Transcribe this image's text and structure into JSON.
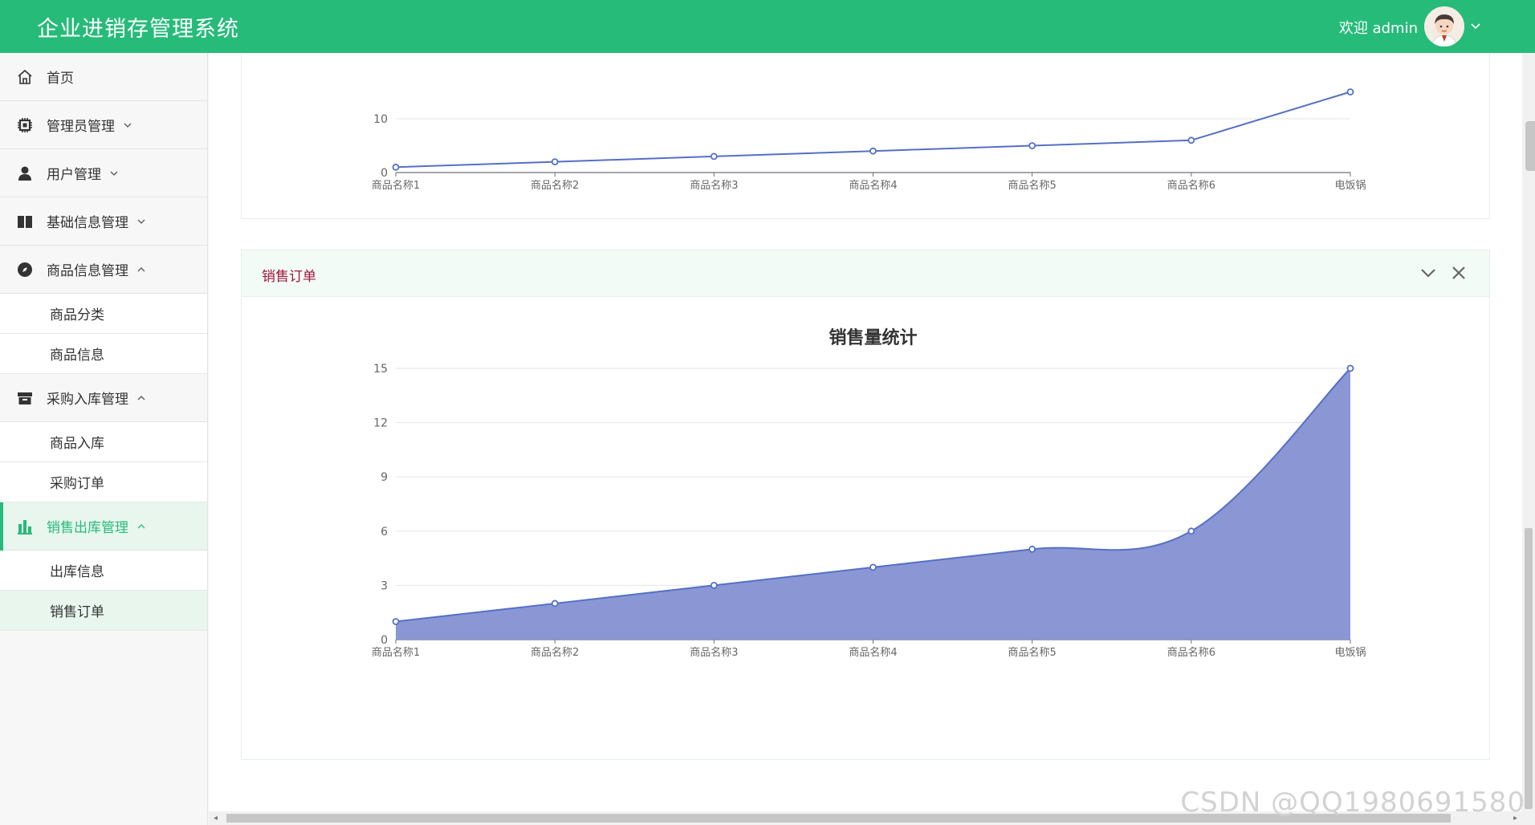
{
  "app": {
    "title": "企业进销存管理系统"
  },
  "header": {
    "welcome": "欢迎 admin"
  },
  "sidebar": {
    "home": "首页",
    "admin_mgmt": "管理员管理",
    "user_mgmt": "用户管理",
    "basic_info": "基础信息管理",
    "goods_info_mgmt": "商品信息管理",
    "goods_category": "商品分类",
    "goods_info": "商品信息",
    "purchase_mgmt": "采购入库管理",
    "goods_inbound": "商品入库",
    "purchase_order": "采购订单",
    "sales_mgmt": "销售出库管理",
    "outbound_info": "出库信息",
    "sales_order": "销售订单"
  },
  "panels": {
    "sales_title": "销售订单"
  },
  "chart_data": [
    {
      "type": "line",
      "categories": [
        "商品名称1",
        "商品名称2",
        "商品名称3",
        "商品名称4",
        "商品名称5",
        "商品名称6",
        "电饭锅"
      ],
      "values": [
        1,
        2,
        3,
        4,
        5,
        6,
        15
      ],
      "visible_yticks": [
        "0",
        "10"
      ],
      "ylim": [
        0,
        15
      ],
      "grid": true
    },
    {
      "type": "area",
      "title": "销售量统计",
      "categories": [
        "商品名称1",
        "商品名称2",
        "商品名称3",
        "商品名称4",
        "商品名称5",
        "商品名称6",
        "电饭锅"
      ],
      "values": [
        1,
        2,
        3,
        4,
        5,
        6,
        15
      ],
      "yticks": [
        "0",
        "3",
        "6",
        "9",
        "12",
        "15"
      ],
      "ylim": [
        0,
        15
      ],
      "grid": true,
      "smooth": true
    }
  ],
  "colors": {
    "brand": "#26bb79",
    "series_line": "#5470c6",
    "series_area": "#8a97d4",
    "panel_title": "#a0153e"
  },
  "watermark": "CSDN @QQ1980691580"
}
